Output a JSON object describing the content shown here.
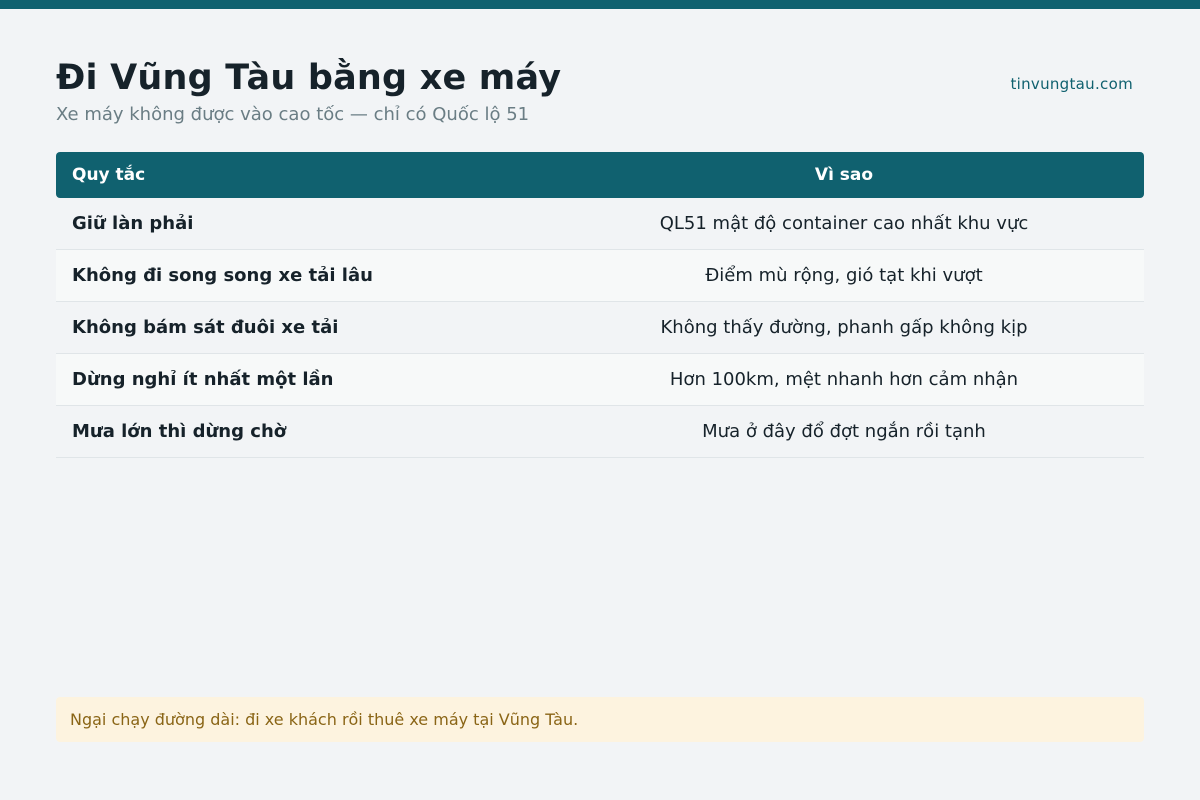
{
  "header": {
    "title": "Đi Vũng Tàu bằng xe máy",
    "subtitle": "Xe máy không được vào cao tốc — chỉ có Quốc lộ 51",
    "site": "tinvungtau.com"
  },
  "table": {
    "columns": [
      "Quy tắc",
      "Vì sao"
    ],
    "rows": [
      {
        "rule": "Giữ làn phải",
        "reason": "QL51 mật độ container cao nhất khu vực"
      },
      {
        "rule": "Không đi song song xe tải lâu",
        "reason": "Điểm mù rộng, gió tạt khi vượt"
      },
      {
        "rule": "Không bám sát đuôi xe tải",
        "reason": "Không thấy đường, phanh gấp không kịp"
      },
      {
        "rule": "Dừng nghỉ ít nhất một lần",
        "reason": "Hơn 100km, mệt nhanh hơn cảm nhận"
      },
      {
        "rule": "Mưa lớn thì dừng chờ",
        "reason": "Mưa ở đây đổ đợt ngắn rồi tạnh"
      }
    ]
  },
  "note": {
    "text": "Ngại chạy đường dài: đi xe khách rồi thuê xe máy tại Vũng Tàu."
  },
  "colors": {
    "accent": "#10616f",
    "note_bg": "#fdf3df",
    "note_text": "#8a6516"
  }
}
